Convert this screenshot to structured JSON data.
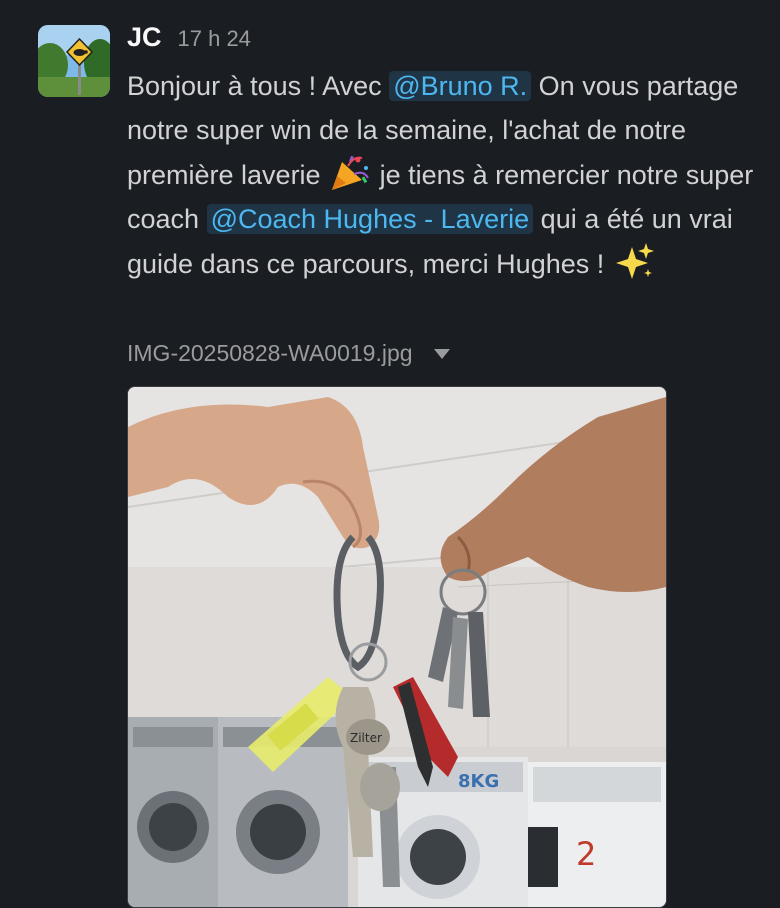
{
  "message": {
    "author": "JC",
    "timestamp": "17 h 24",
    "avatar_icon": "turtle-crossing-sign-icon",
    "text": {
      "part1": "Bonjour à tous ! Avec",
      "mention1": "@Bruno R.",
      "part2": "On vous partage notre super win de la semaine, l'achat de notre première laverie",
      "emoji1": "party-popper-icon",
      "part3": "je tiens à remercier notre super coach",
      "mention2": "@Coach Hughes - Laverie",
      "part4": "qui a été un vrai guide dans ce parcours, merci Hughes !",
      "emoji2": "sparkles-icon"
    },
    "attachment": {
      "filename": "IMG-20250828-WA0019.jpg",
      "expand_icon": "caret-down-icon",
      "image_icon": "photo-hands-holding-keys-in-laundromat",
      "washer_label": "8KG",
      "washer_number": "2",
      "keychain_label": "Zilter"
    }
  },
  "colors": {
    "background": "#1a1d21",
    "text": "#d1d2d3",
    "mention_text": "#4db7f1",
    "mention_bg": "#1f3444",
    "muted": "#9a9b9e"
  }
}
